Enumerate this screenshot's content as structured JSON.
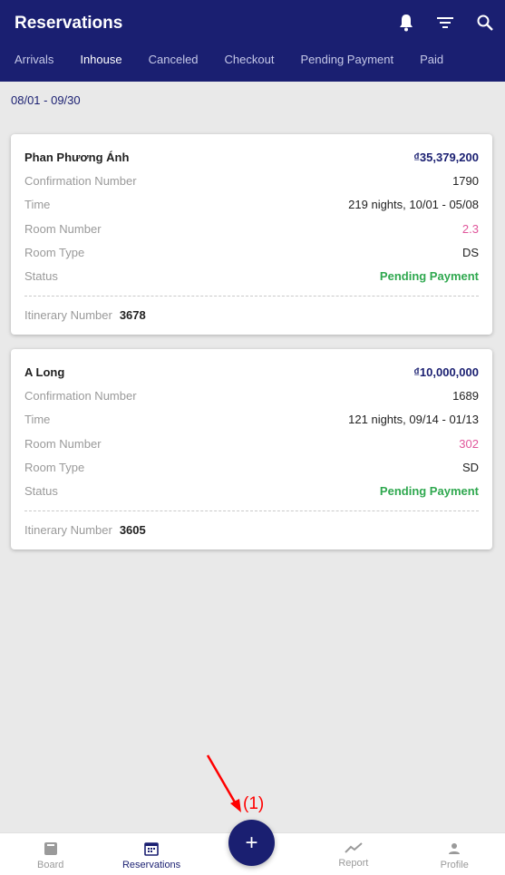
{
  "header": {
    "title": "Reservations",
    "tabs": [
      {
        "label": "Arrivals"
      },
      {
        "label": "Inhouse"
      },
      {
        "label": "Canceled"
      },
      {
        "label": "Checkout"
      },
      {
        "label": "Pending Payment"
      },
      {
        "label": "Paid"
      }
    ],
    "active_tab": "Inhouse",
    "icons": [
      "bell-icon",
      "filter-icon",
      "search-icon"
    ]
  },
  "date_range": "08/01 - 09/30",
  "labels": {
    "confirmation": "Confirmation Number",
    "time": "Time",
    "room_number": "Room Number",
    "room_type": "Room Type",
    "status": "Status",
    "itinerary": "Itinerary Number"
  },
  "reservations": [
    {
      "guest": "Phan Phương Ánh",
      "amount": "₫35,379,200",
      "confirmation": "1790",
      "time": "219 nights, 10/01 - 05/08",
      "room_number": "2.3",
      "room_type": "DS",
      "status": "Pending Payment",
      "itinerary": "3678"
    },
    {
      "guest": "A Long",
      "amount": "₫10,000,000",
      "confirmation": "1689",
      "time": "121 nights, 09/14 - 01/13",
      "room_number": "302",
      "room_type": "SD",
      "status": "Pending Payment",
      "itinerary": "3605"
    }
  ],
  "bottom_nav": [
    {
      "label": "Board",
      "icon": "board-icon"
    },
    {
      "label": "Reservations",
      "icon": "calendar-icon"
    },
    {
      "label": "Report",
      "icon": "trend-icon"
    },
    {
      "label": "Profile",
      "icon": "person-icon"
    }
  ],
  "fab": {
    "label": "+"
  },
  "annotation": "(1)",
  "colors": {
    "brand": "#1a1f71",
    "room": "#e0569b",
    "status": "#2fa84f"
  }
}
